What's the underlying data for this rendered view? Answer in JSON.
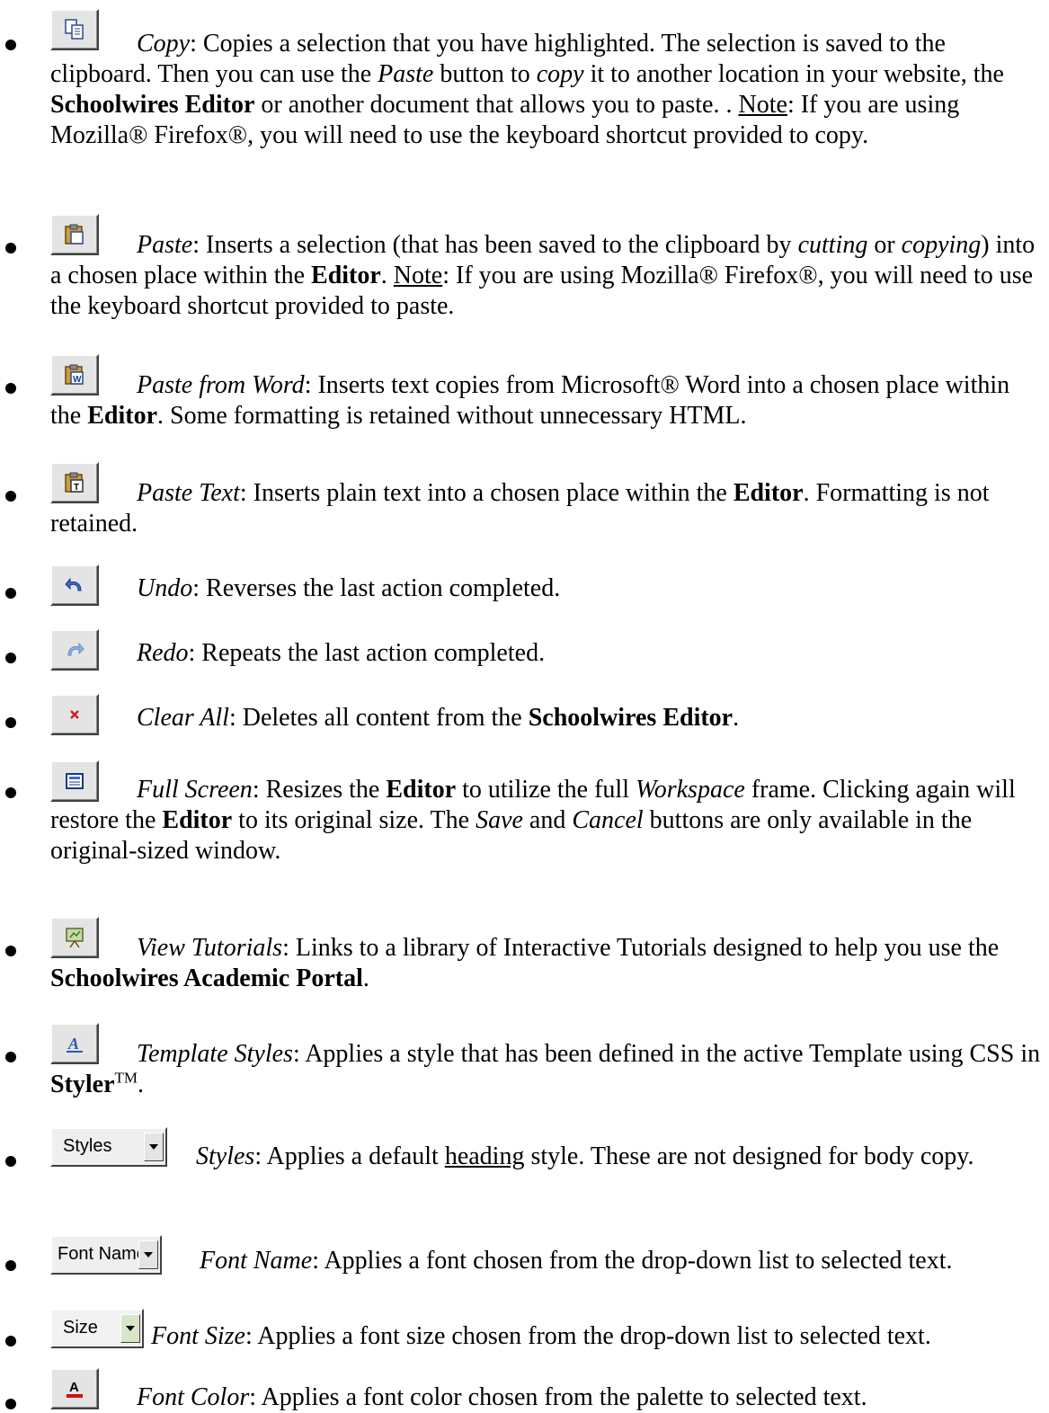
{
  "items": [
    {
      "icon": "copy-icon",
      "name": "Copy",
      "desc_1": ": Copies a selection that you have highlighted. The selection is saved to the clipboard. Then you can use the ",
      "em_1": "Paste",
      "desc_2": " button to ",
      "em_2": "copy",
      "desc_3": " it to another location in your website, the ",
      "strong_1": "Schoolwires Editor",
      "desc_4": " or another document that allows you to paste. . ",
      "note": "Note",
      "desc_5": ": If you are using Mozilla® Firefox®, you will need to use the keyboard shortcut provided to copy."
    },
    {
      "icon": "paste-icon",
      "name": "Paste",
      "desc_1": ": Inserts a selection (that has been saved to the clipboard by ",
      "em_1": "cutting",
      "desc_2": " or ",
      "em_2": "copying",
      "desc_3": ") into a chosen place within the ",
      "strong_1": "Editor",
      "desc_4": ". ",
      "note": "Note",
      "desc_5": ": If you are using Mozilla® Firefox®, you will need to use the keyboard shortcut provided to paste."
    },
    {
      "icon": "paste-from-word-icon",
      "name": "Paste from Word",
      "desc_1": ":  Inserts text copies from Microsoft® Word into a chosen place within the ",
      "strong_1": "Editor",
      "desc_2": ". Some formatting is retained without unnecessary HTML."
    },
    {
      "icon": "paste-text-icon",
      "name": "Paste Text",
      "desc_1": ": Inserts plain text into a chosen place within the ",
      "strong_1": "Editor",
      "desc_2": ". Formatting is not retained."
    },
    {
      "icon": "undo-icon",
      "name": "Undo",
      "desc_1": ": Reverses the last action completed."
    },
    {
      "icon": "redo-icon",
      "name": "Redo",
      "desc_1": ": Repeats the last action completed."
    },
    {
      "icon": "clear-all-icon",
      "name": "Clear All",
      "desc_1": ": Deletes all content from the ",
      "strong_1": "Schoolwires Editor",
      "desc_2": "."
    },
    {
      "icon": "full-screen-icon",
      "name": "Full Screen",
      "desc_1": ": Resizes the ",
      "strong_1": "Editor",
      "desc_2": " to utilize the full ",
      "em_1": "Workspace",
      "desc_3": " frame. Clicking again will restore the ",
      "strong_2": "Editor",
      "desc_4": " to its original size. The ",
      "em_2": "Save",
      "desc_5": " and ",
      "em_3": "Cancel",
      "desc_6": " buttons are only available in the original-sized window."
    },
    {
      "icon": "view-tutorials-icon",
      "name": "View Tutorials",
      "desc_1": ": Links to a library of Interactive Tutorials designed to help you use the ",
      "strong_1": "Schoolwires Academic Portal",
      "desc_2": "."
    },
    {
      "icon": "template-styles-icon",
      "name": "Template Styles",
      "desc_1": ": Applies a style that has been defined in the active Template using CSS in ",
      "strong_1": "Styler",
      "tm": "TM",
      "desc_2": "."
    },
    {
      "control": "Styles",
      "name": "Styles",
      "desc_1": ": Applies a default ",
      "u_1": "heading",
      "desc_2": " style. These are not designed for body copy."
    },
    {
      "control": "Font Name",
      "name": "Font Name",
      "desc_1": ": Applies a font chosen from the drop-down list to selected text."
    },
    {
      "control": "Size",
      "name": "Font Size",
      "desc_1": ": Applies a font size chosen from the drop-down list to selected text."
    },
    {
      "icon": "font-color-icon",
      "name": "Font Color",
      "desc_1": ": Applies a font color chosen from the palette to selected text."
    }
  ]
}
